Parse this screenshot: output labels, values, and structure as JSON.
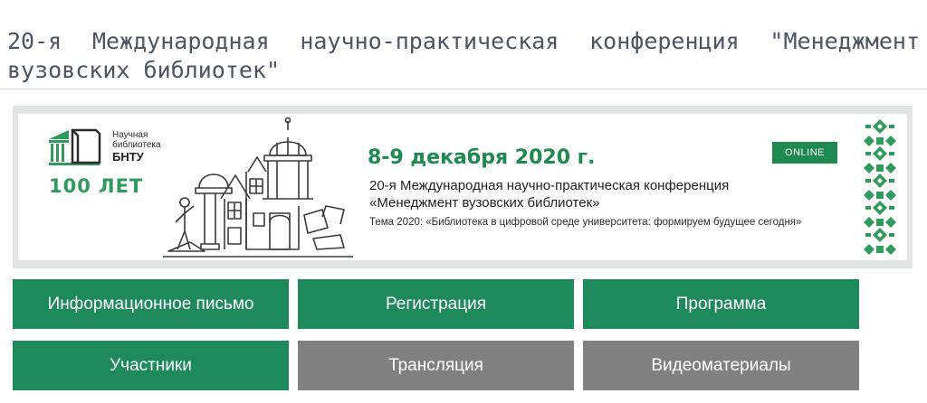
{
  "page": {
    "title": "20-я Международная научно-практическая конференция \"Менеджмент вузовских библиотек\""
  },
  "banner": {
    "logo": {
      "line1": "Научная",
      "line2": "библиотека",
      "line3": "БНТУ",
      "years": "100 ЛЕТ"
    },
    "dates": "8-9 декабря 2020 г.",
    "online_badge": "ONLINE",
    "conference_line1": "20-я Международная научно-практическая конференция",
    "conference_line2": "«Менеджмент вузовских библиотек»",
    "theme": "Тема 2020: «Библиотека в цифровой среде университета: формируем будущее сегодня»",
    "colors": {
      "accent_green": "#1e8a50",
      "button_green": "#1e8a5c",
      "button_gray": "#808080",
      "frame_gray": "#e3e4e4"
    }
  },
  "buttons": [
    {
      "label": "Информационное письмо",
      "style": "green"
    },
    {
      "label": "Регистрация",
      "style": "green"
    },
    {
      "label": "Программа",
      "style": "green"
    },
    {
      "label": "Участники",
      "style": "green"
    },
    {
      "label": "Трансляция",
      "style": "gray"
    },
    {
      "label": "Видеоматериалы",
      "style": "gray"
    }
  ]
}
